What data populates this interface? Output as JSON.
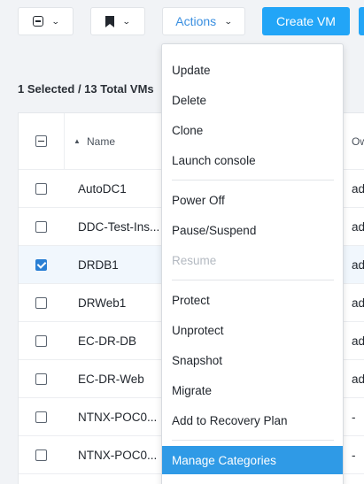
{
  "toolbar": {
    "actions_label": "Actions",
    "create_label": "Create VM"
  },
  "summary": {
    "selected": "1 Selected",
    "total": " / 13 Total VMs"
  },
  "table": {
    "columns": [
      "Name",
      "Ow"
    ],
    "sort_indicator": "▲",
    "rows": [
      {
        "name": "AutoDC1",
        "owner": "ad",
        "checked": false
      },
      {
        "name": "DDC-Test-Ins...",
        "owner": "ad",
        "checked": false
      },
      {
        "name": "DRDB1",
        "owner": "ad",
        "checked": true
      },
      {
        "name": "DRWeb1",
        "owner": "ad",
        "checked": false
      },
      {
        "name": "EC-DR-DB",
        "owner": "ad",
        "checked": false
      },
      {
        "name": "EC-DR-Web",
        "owner": "ad",
        "checked": false
      },
      {
        "name": "NTNX-POC0...",
        "owner": "-",
        "checked": false
      },
      {
        "name": "NTNX-POC0...",
        "owner": "-",
        "checked": false
      }
    ]
  },
  "menu": {
    "items": [
      "Update",
      "Delete",
      "Clone",
      "Launch console",
      "Power Off",
      "Pause/Suspend",
      "Resume",
      "Protect",
      "Unprotect",
      "Snapshot",
      "Migrate",
      "Add to Recovery Plan",
      "Manage Categories"
    ],
    "disabled_item": "Resume",
    "highlighted_item": "Manage Categories"
  },
  "colors": {
    "accent": "#22a5f7",
    "menu_highlight": "#2f9ae6",
    "checkbox_checked": "#2a7fd4"
  }
}
